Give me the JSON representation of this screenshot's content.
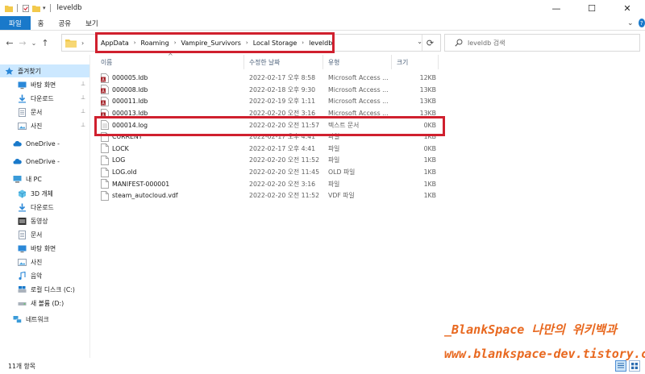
{
  "window": {
    "title": "leveldb",
    "minimize_glyph": "—",
    "maximize_glyph": "☐",
    "close_glyph": "✕"
  },
  "ribbon": {
    "tabs": [
      "파일",
      "홈",
      "공유",
      "보기"
    ],
    "expand_glyph": "⌄",
    "help_glyph": "?"
  },
  "nav": {
    "back_glyph": "←",
    "forward_glyph": "→",
    "recent_glyph": "⌄",
    "up_glyph": "↑"
  },
  "address": {
    "root_chevron": "›",
    "crumbs": [
      "AppData",
      "Roaming",
      "Vampire_Survivors",
      "Local Storage",
      "leveldb"
    ],
    "separator": "›",
    "dropdown_glyph": "⌄",
    "refresh_glyph": "⟳"
  },
  "search": {
    "placeholder": "leveldb 검색"
  },
  "sidebar": {
    "quick_access": "즐겨찾기",
    "items": [
      {
        "label": "바탕 화면",
        "icon": "desktop-icon",
        "pinned": true
      },
      {
        "label": "다운로드",
        "icon": "download-icon",
        "pinned": true
      },
      {
        "label": "문서",
        "icon": "documents-icon",
        "pinned": true
      },
      {
        "label": "사진",
        "icon": "pictures-icon",
        "pinned": true
      }
    ],
    "onedrive": [
      "OneDrive -",
      "OneDrive -"
    ],
    "this_pc": "내 PC",
    "pc_items": [
      {
        "label": "3D 개체",
        "icon": "3d-objects-icon"
      },
      {
        "label": "다운로드",
        "icon": "download-icon"
      },
      {
        "label": "동영상",
        "icon": "videos-icon"
      },
      {
        "label": "문서",
        "icon": "documents-icon"
      },
      {
        "label": "바탕 화면",
        "icon": "desktop-icon"
      },
      {
        "label": "사진",
        "icon": "pictures-icon"
      },
      {
        "label": "음악",
        "icon": "music-icon"
      },
      {
        "label": "로컬 디스크 (C:)",
        "icon": "local-disk-icon"
      },
      {
        "label": "새 볼륨 (D:)",
        "icon": "volume-icon"
      }
    ],
    "network": "네트워크",
    "pin_glyph": "📌"
  },
  "columns": {
    "name": "이름",
    "date": "수정한 날짜",
    "type": "유형",
    "size": "크기",
    "sort_glyph": "^"
  },
  "files": [
    {
      "name": "000005.ldb",
      "date": "2022-02-17 오후 8:58",
      "type": "Microsoft Access ...",
      "size": "12KB",
      "icon": "access-db-icon"
    },
    {
      "name": "000008.ldb",
      "date": "2022-02-18 오후 9:30",
      "type": "Microsoft Access ...",
      "size": "13KB",
      "icon": "access-db-icon"
    },
    {
      "name": "000011.ldb",
      "date": "2022-02-19 오후 1:11",
      "type": "Microsoft Access ...",
      "size": "13KB",
      "icon": "access-db-icon"
    },
    {
      "name": "000013.ldb",
      "date": "2022-02-20 오전 3:16",
      "type": "Microsoft Access ...",
      "size": "13KB",
      "icon": "access-db-icon"
    },
    {
      "name": "000014.log",
      "date": "2022-02-20 오전 11:57",
      "type": "텍스트 문서",
      "size": "0KB",
      "icon": "text-file-icon"
    },
    {
      "name": "CURRENT",
      "date": "2022-02-17 오후 4:41",
      "type": "파일",
      "size": "1KB",
      "icon": "file-icon"
    },
    {
      "name": "LOCK",
      "date": "2022-02-17 오후 4:41",
      "type": "파일",
      "size": "0KB",
      "icon": "file-icon"
    },
    {
      "name": "LOG",
      "date": "2022-02-20 오전 11:52",
      "type": "파일",
      "size": "1KB",
      "icon": "file-icon"
    },
    {
      "name": "LOG.old",
      "date": "2022-02-20 오전 11:45",
      "type": "OLD 파일",
      "size": "1KB",
      "icon": "file-icon"
    },
    {
      "name": "MANIFEST-000001",
      "date": "2022-02-20 오전 3:16",
      "type": "파일",
      "size": "1KB",
      "icon": "file-icon"
    },
    {
      "name": "steam_autocloud.vdf",
      "date": "2022-02-20 오전 11:52",
      "type": "VDF 파일",
      "size": "1KB",
      "icon": "file-icon"
    }
  ],
  "status": {
    "count": "11개 항목"
  },
  "watermark": {
    "line1": "_BlankSpace 나만의 위키백과",
    "line2": "www.blankspace-dev.tistory.com"
  },
  "colors": {
    "accent": "#1979ca",
    "highlight_box": "#d0202e",
    "watermark": "#e8681f",
    "selection": "#cce8ff"
  }
}
